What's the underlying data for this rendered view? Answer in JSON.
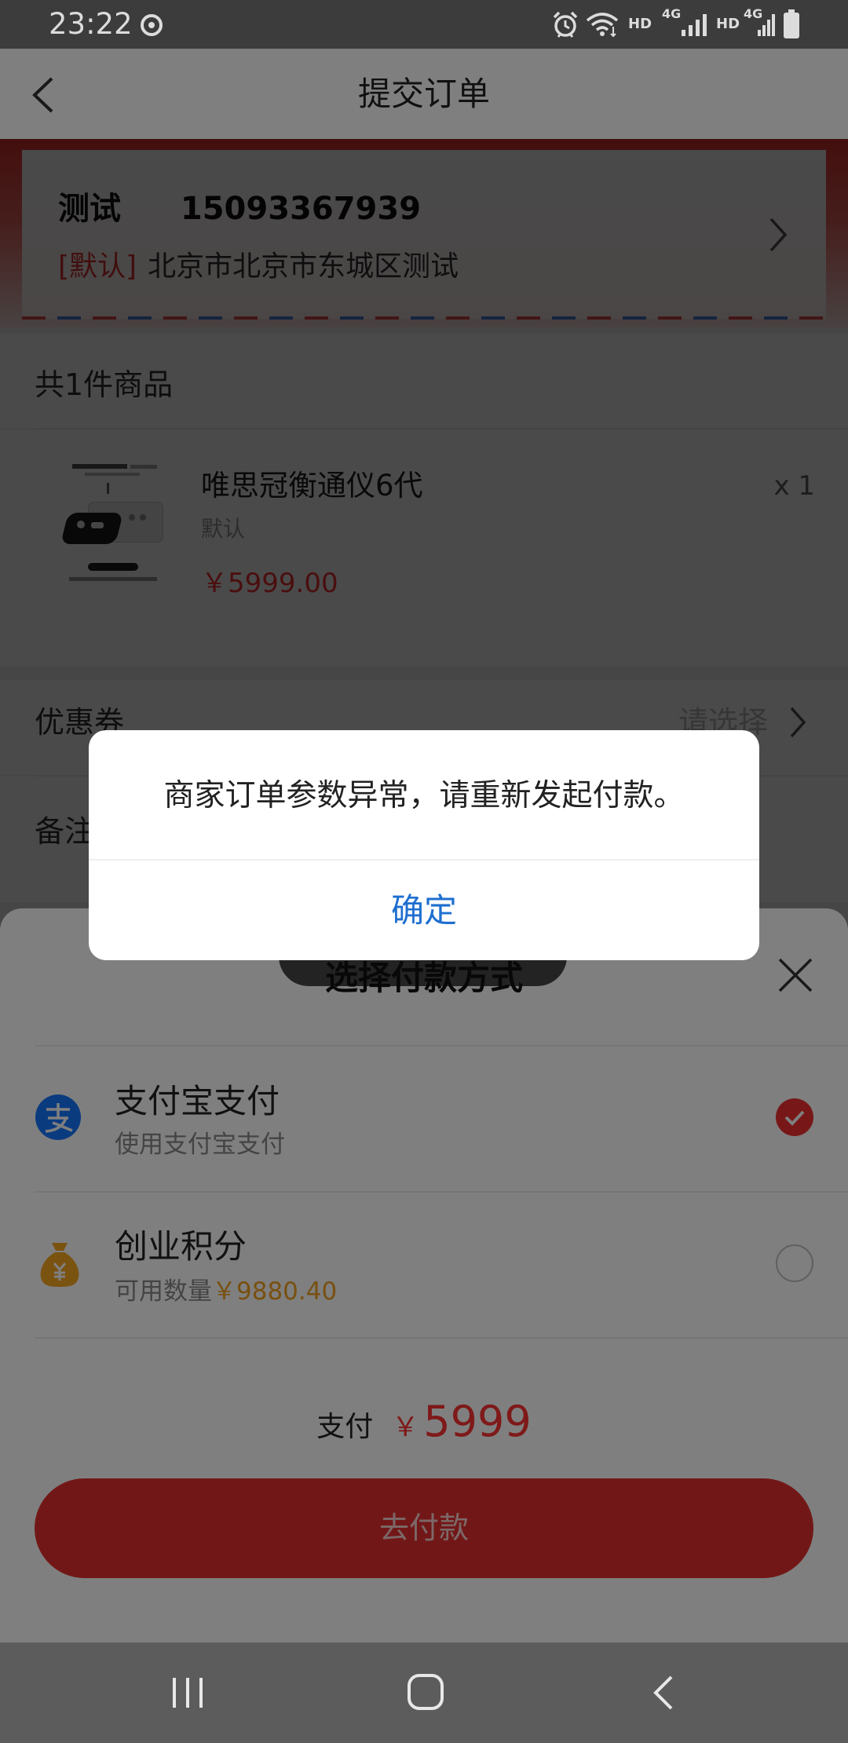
{
  "status_bar": {
    "time": "23:22",
    "hd_1": "HD",
    "net_1": "4G",
    "hd_2": "HD",
    "net_2": "4G"
  },
  "header": {
    "title": "提交订单"
  },
  "address": {
    "name": "测试",
    "phone": "15093367939",
    "default_tag": "[默认]",
    "detail": "北京市北京市东城区测试"
  },
  "order": {
    "count_label": "共1件商品",
    "items": [
      {
        "name": "唯思冠衡通仪6代",
        "spec": "默认",
        "price": "￥5999.00",
        "quantity": "x 1"
      }
    ]
  },
  "coupon": {
    "label": "优惠券",
    "value": "请选择"
  },
  "remark": {
    "label": "备注"
  },
  "payment_sheet": {
    "title": "选择付款方式",
    "methods": [
      {
        "icon": "alipay-icon",
        "name": "支付宝支付",
        "desc": "使用支付宝支付",
        "selected": true
      },
      {
        "icon": "money-bag-icon",
        "name": "创业积分",
        "desc": "可用数量",
        "balance": "￥9880.40",
        "selected": false
      }
    ],
    "total_label": "支付",
    "currency": "￥",
    "total_amount": "5999",
    "pay_button_label": "去付款"
  },
  "dialog": {
    "message": "商家订单参数异常，请重新发起付款。",
    "confirm_label": "确定"
  },
  "colors": {
    "accent_red": "#e52e2e",
    "link_blue": "#1e6fd0",
    "points_orange": "#f0a020",
    "alipay_blue": "#1677ff"
  }
}
